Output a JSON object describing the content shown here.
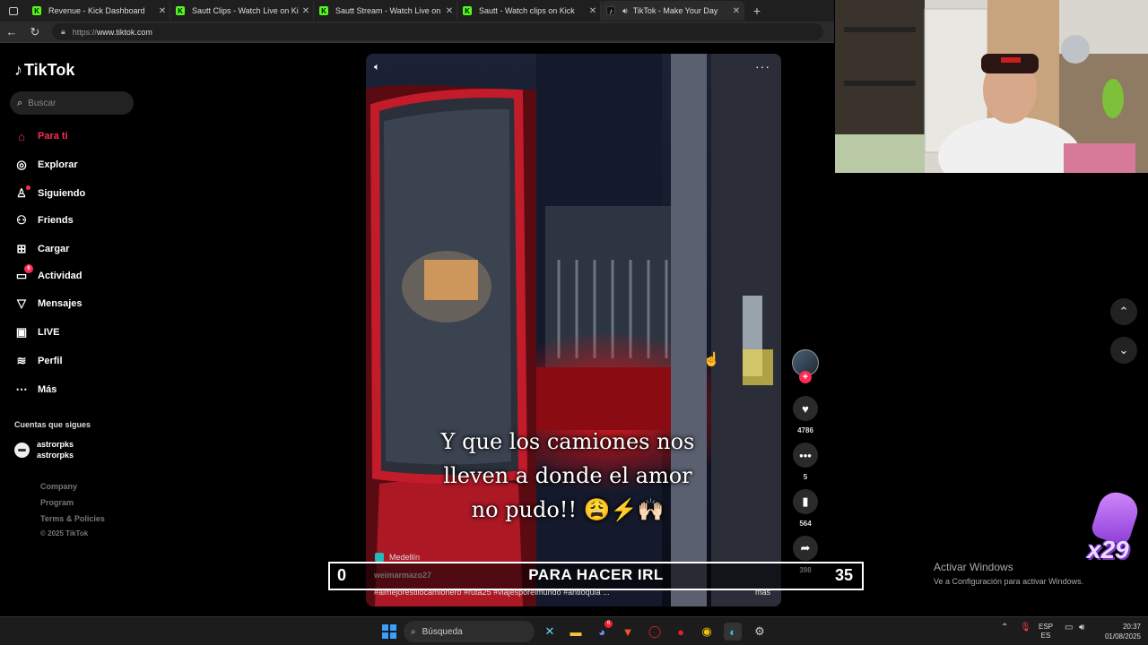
{
  "browser": {
    "tabs": [
      {
        "label": "Revenue - Kick Dashboard",
        "favicon": "kick-icon",
        "active": false
      },
      {
        "label": "Sautt Clips - Watch Live on Kick",
        "favicon": "kick-icon",
        "active": false
      },
      {
        "label": "Sautt Stream - Watch Live on Kick",
        "favicon": "kick-icon",
        "active": false
      },
      {
        "label": "Sautt - Watch clips on Kick",
        "favicon": "kick-icon",
        "active": false
      },
      {
        "label": "TikTok - Make Your Day",
        "favicon": "tiktok-icon",
        "active": true
      }
    ],
    "url_scheme": "https://",
    "url_host": "www.tiktok.com"
  },
  "sidebar": {
    "logo": "TikTok",
    "search_placeholder": "Buscar",
    "items": [
      {
        "label": "Para ti",
        "icon": "home-icon",
        "active": true
      },
      {
        "label": "Explorar",
        "icon": "compass-icon"
      },
      {
        "label": "Siguiendo",
        "icon": "following-icon"
      },
      {
        "label": "Friends",
        "icon": "friends-icon"
      },
      {
        "label": "Cargar",
        "icon": "upload-icon"
      },
      {
        "label": "Actividad",
        "icon": "activity-icon",
        "badge": "6"
      },
      {
        "label": "Mensajes",
        "icon": "messages-icon"
      },
      {
        "label": "LIVE",
        "icon": "live-icon"
      },
      {
        "label": "Perfil",
        "icon": "profile-icon"
      },
      {
        "label": "Más",
        "icon": "more-icon"
      }
    ],
    "following_title": "Cuentas que sigues",
    "following": [
      {
        "name": "astrorpks",
        "handle": "astrorpks"
      }
    ],
    "footer": [
      "Company",
      "Program",
      "Terms & Policies",
      "© 2025 TikTok"
    ]
  },
  "video": {
    "caption_lines": [
      "Y que los camiones nos",
      "lleven a donde el amor",
      "no pudo!! 😩⚡🙌🏻"
    ],
    "location": "Medellín",
    "author": "weimarmazo27",
    "hashtags": "#almejorestilocamionero #ruta25 #viajesporelmundo #antioquia ...",
    "more": "más",
    "actions": {
      "likes": "4786",
      "comments": "5",
      "saves": "564",
      "shares": "398"
    }
  },
  "overlay": {
    "score_left": "0",
    "title": "PARA HACER IRL",
    "score_right": "35",
    "multiplier": "x29"
  },
  "watermark": {
    "line1": "Activar Windows",
    "line2": "Ve a Configuración para activar Windows."
  },
  "taskbar": {
    "search_label": "Búsqueda",
    "discord_badge": "6",
    "lang_top": "ESP",
    "lang_bottom": "ES",
    "time": "20:37",
    "date": "01/08/2025"
  },
  "colors": {
    "accent": "#fe2c55",
    "background": "#000000",
    "kick_green": "#53fc18"
  }
}
